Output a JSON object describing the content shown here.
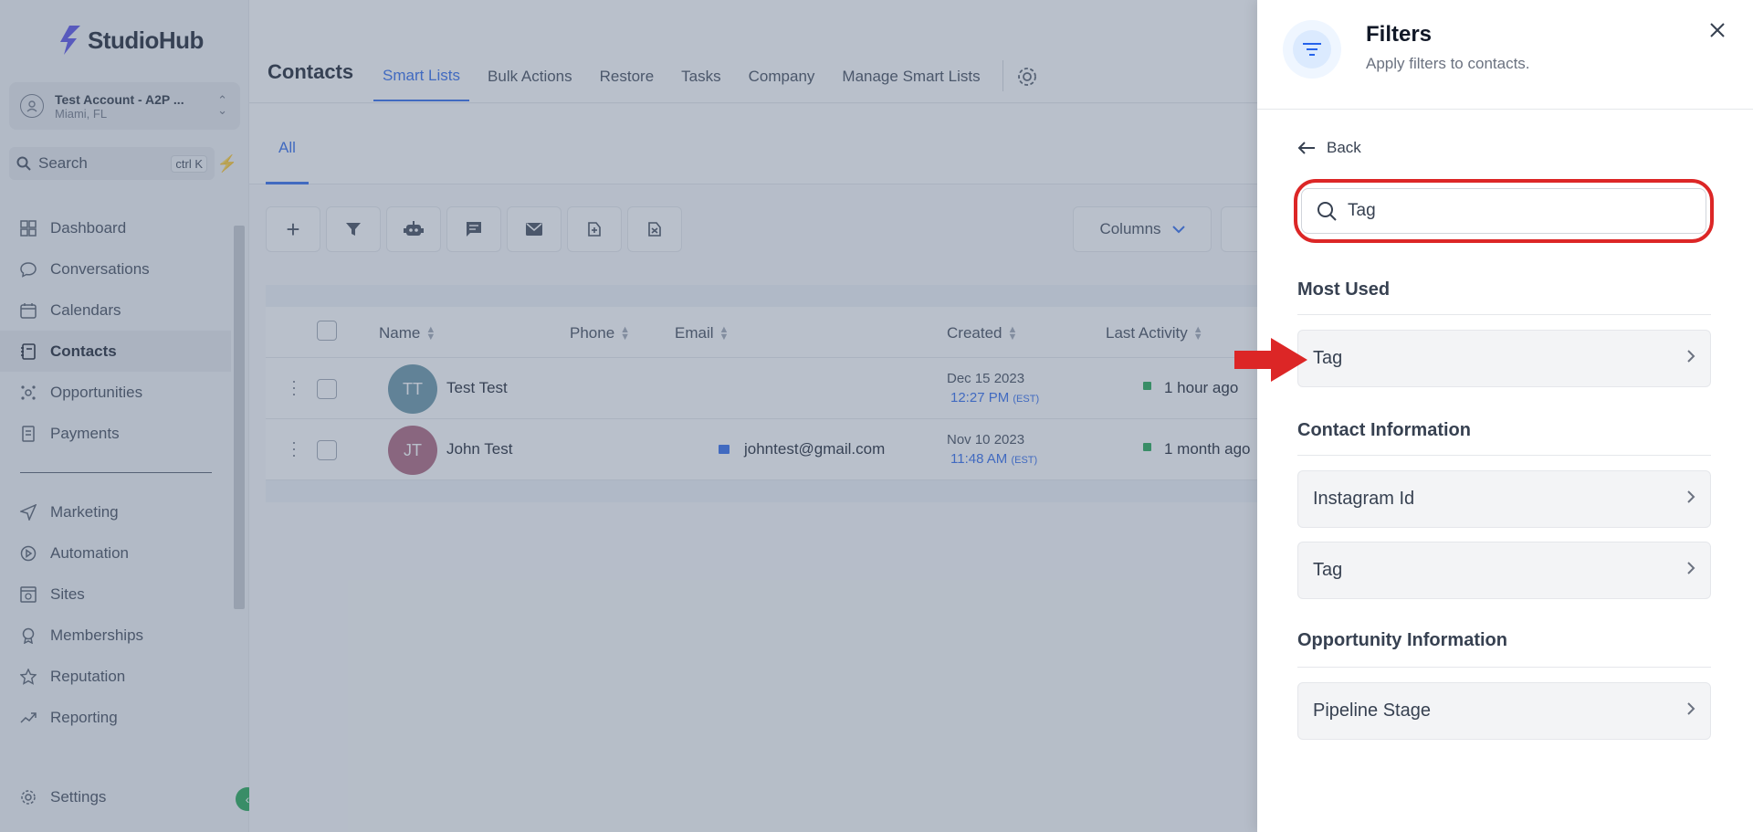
{
  "brand": {
    "name": "StudioHub"
  },
  "account": {
    "name": "Test Account - A2P ...",
    "location": "Miami, FL"
  },
  "sidebar_search": {
    "label": "Search",
    "shortcut": "ctrl K"
  },
  "nav": [
    {
      "label": "Dashboard",
      "icon": "dashboard-icon"
    },
    {
      "label": "Conversations",
      "icon": "chat-icon"
    },
    {
      "label": "Calendars",
      "icon": "calendar-icon"
    },
    {
      "label": "Contacts",
      "icon": "contacts-icon",
      "active": true
    },
    {
      "label": "Opportunities",
      "icon": "opportunities-icon"
    },
    {
      "label": "Payments",
      "icon": "payments-icon"
    }
  ],
  "nav2": [
    {
      "label": "Marketing",
      "icon": "send-icon"
    },
    {
      "label": "Automation",
      "icon": "automation-icon"
    },
    {
      "label": "Sites",
      "icon": "sites-icon"
    },
    {
      "label": "Memberships",
      "icon": "award-icon"
    },
    {
      "label": "Reputation",
      "icon": "star-icon"
    },
    {
      "label": "Reporting",
      "icon": "trend-icon"
    }
  ],
  "settings_label": "Settings",
  "header": {
    "title": "Contacts",
    "tabs": [
      "Smart Lists",
      "Bulk Actions",
      "Restore",
      "Tasks",
      "Company",
      "Manage Smart Lists"
    ]
  },
  "subtab": "All",
  "columns_label": "Columns",
  "table": {
    "columns": [
      "Name",
      "Phone",
      "Email",
      "Created",
      "Last Activity"
    ],
    "rows": [
      {
        "initials": "TT",
        "avatar_color": "#5f8fa0",
        "name": "Test Test",
        "phone": "",
        "email": "",
        "created_date": "Dec 15 2023",
        "created_time": "12:27 PM",
        "tz": "(EST)",
        "activity": "1 hour ago"
      },
      {
        "initials": "JT",
        "avatar_color": "#a85c75",
        "name": "John Test",
        "phone": "",
        "email": "johntest@gmail.com",
        "created_date": "Nov 10 2023",
        "created_time": "11:48 AM",
        "tz": "(EST)",
        "activity": "1 month ago"
      }
    ]
  },
  "filters": {
    "title": "Filters",
    "subtitle": "Apply filters to contacts.",
    "back_label": "Back",
    "search_value": "Tag",
    "groups": [
      {
        "title": "Most Used",
        "items": [
          "Tag"
        ]
      },
      {
        "title": "Contact Information",
        "items": [
          "Instagram Id",
          "Tag"
        ]
      },
      {
        "title": "Opportunity Information",
        "items": [
          "Pipeline Stage"
        ]
      }
    ]
  },
  "colors": {
    "accent": "#2563eb",
    "highlight": "#dc2626",
    "success": "#16a34a"
  }
}
